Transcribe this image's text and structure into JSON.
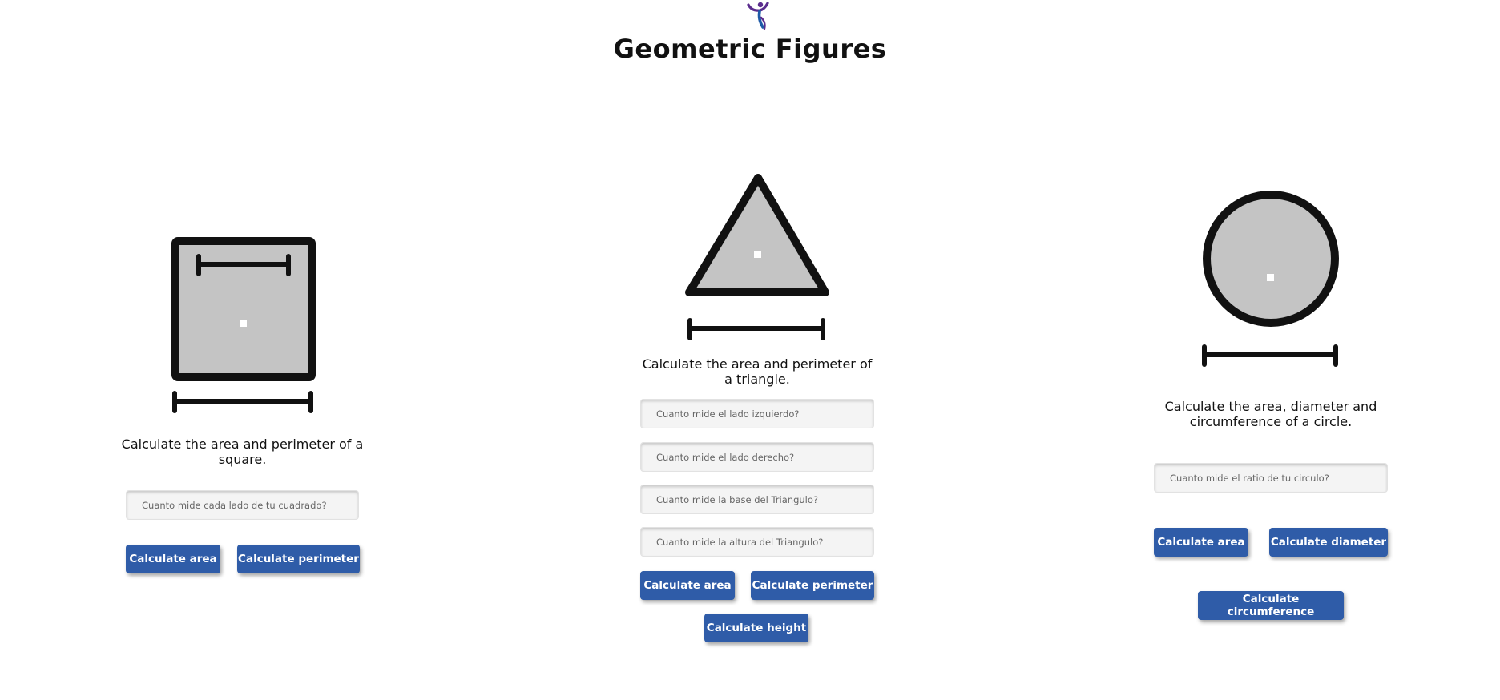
{
  "header": {
    "logo_icon": "person-figure-logo-icon",
    "title": "Geometric Figures"
  },
  "colors": {
    "button_bg": "#2f5ca8",
    "shape_fill": "#c4c4c4",
    "shape_stroke": "#111111",
    "logo_purple": "#5b2d8e",
    "logo_blue": "#1e5aa8"
  },
  "square": {
    "icon": "square-figure-icon",
    "description": "Calculate the area and perimeter of a square.",
    "side_placeholder": "Cuanto mide cada lado de tu cuadrado?",
    "area_button": "Calculate area",
    "perimeter_button": "Calculate perimeter"
  },
  "triangle": {
    "icon": "triangle-figure-icon",
    "description": "Calculate the area and perimeter of a triangle.",
    "left_side_placeholder": "Cuanto mide el lado izquierdo?",
    "right_side_placeholder": "Cuanto mide el lado derecho?",
    "base_placeholder": "Cuanto mide la base del Triangulo?",
    "height_placeholder": "Cuanto mide la altura del Triangulo?",
    "area_button": "Calculate area",
    "perimeter_button": "Calculate perimeter",
    "height_button": "Calculate height"
  },
  "circle": {
    "icon": "circle-figure-icon",
    "description": "Calculate the area, diameter and circumference of a circle.",
    "radius_placeholder": "Cuanto mide el ratio de tu circulo?",
    "area_button": "Calculate area",
    "diameter_button": "Calculate diameter",
    "circumference_button": "Calculate circumference"
  }
}
